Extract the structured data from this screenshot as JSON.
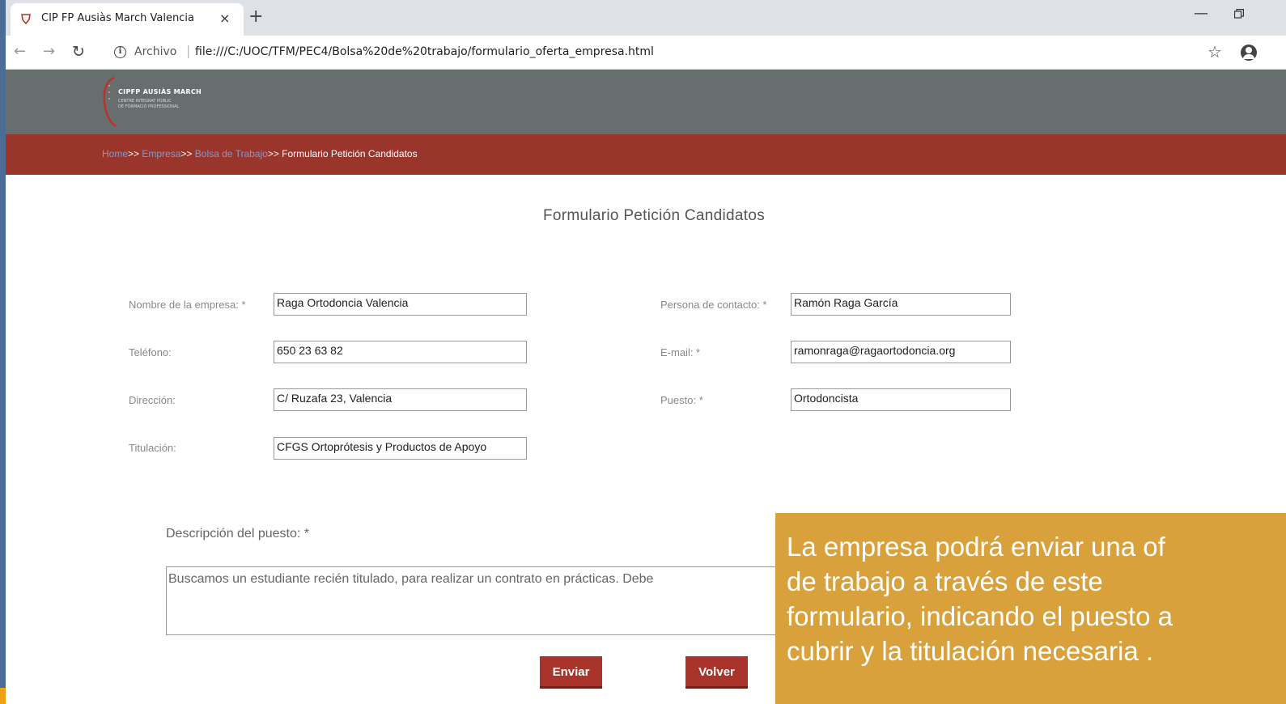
{
  "browser": {
    "tab_title": "CIP FP Ausiàs March Valencia",
    "tab_close": "×",
    "new_tab": "+",
    "url_scheme": "Archivo",
    "url_separator": "|",
    "url": "file:///C:/UOC/TFM/PEC4/Bolsa%20de%20trabajo/formulario_oferta_empresa.html",
    "icons": {
      "back": "back-arrow-icon",
      "forward": "forward-arrow-icon",
      "reload": "reload-icon",
      "info": "info-icon",
      "bookmark": "star-icon",
      "profile": "profile-icon",
      "minimize": "minimize-icon",
      "restore": "restore-icon"
    }
  },
  "header": {
    "logo_name": "CIPFP AUSIÀS MARCH",
    "logo_line1": "CENTRE INTEGRAT PÚBLIC",
    "logo_line2": "DE FORMACIÓ PROFESSIONAL",
    "background": "#676e6e"
  },
  "breadcrumb": {
    "items": [
      {
        "label": "Home",
        "link": true
      },
      {
        "label": ">> ",
        "link": false
      },
      {
        "label": "Empresa",
        "link": true
      },
      {
        "label": ">> ",
        "link": false
      },
      {
        "label": "Bolsa de Trabajo",
        "link": true
      },
      {
        "label": ">> Formulario Petición Candidatos",
        "link": false
      }
    ],
    "background": "#9a352c"
  },
  "form": {
    "title": "Formulario Petición Candidatos",
    "fields": {
      "empresa": {
        "label": "Nombre de la empresa: *",
        "value": "Raga Ortodoncia Valencia"
      },
      "contacto": {
        "label": "Persona de contacto: *",
        "value": "Ramón Raga García"
      },
      "telefono": {
        "label": "Teléfono:",
        "value": "650 23 63 82"
      },
      "email": {
        "label": "E-mail: *",
        "value": "ramonraga@ragaortodoncia.org"
      },
      "direccion": {
        "label": "Dirección:",
        "value": "C/ Ruzafa 23, Valencia"
      },
      "puesto": {
        "label": "Puesto: *",
        "value": "Ortodoncista"
      },
      "titulacion": {
        "label": "Titulación:",
        "value": "CFGS Ortoprótesis y Productos de Apoyo"
      }
    },
    "description": {
      "label": "Descripción del puesto: *",
      "value": "Buscamos un estudiante recién titulado, para realizar un contrato en prácticas. Debe"
    },
    "buttons": {
      "send": "Enviar",
      "back": "Volver"
    },
    "accent_color": "#a8342b"
  },
  "callout": {
    "lines": [
      "La empresa podrá enviar una of",
      "de trabajo a través de este",
      "formulario, indicando el puesto a",
      "cubrir y la titulación necesaria ."
    ],
    "background": "#d9a13c"
  }
}
